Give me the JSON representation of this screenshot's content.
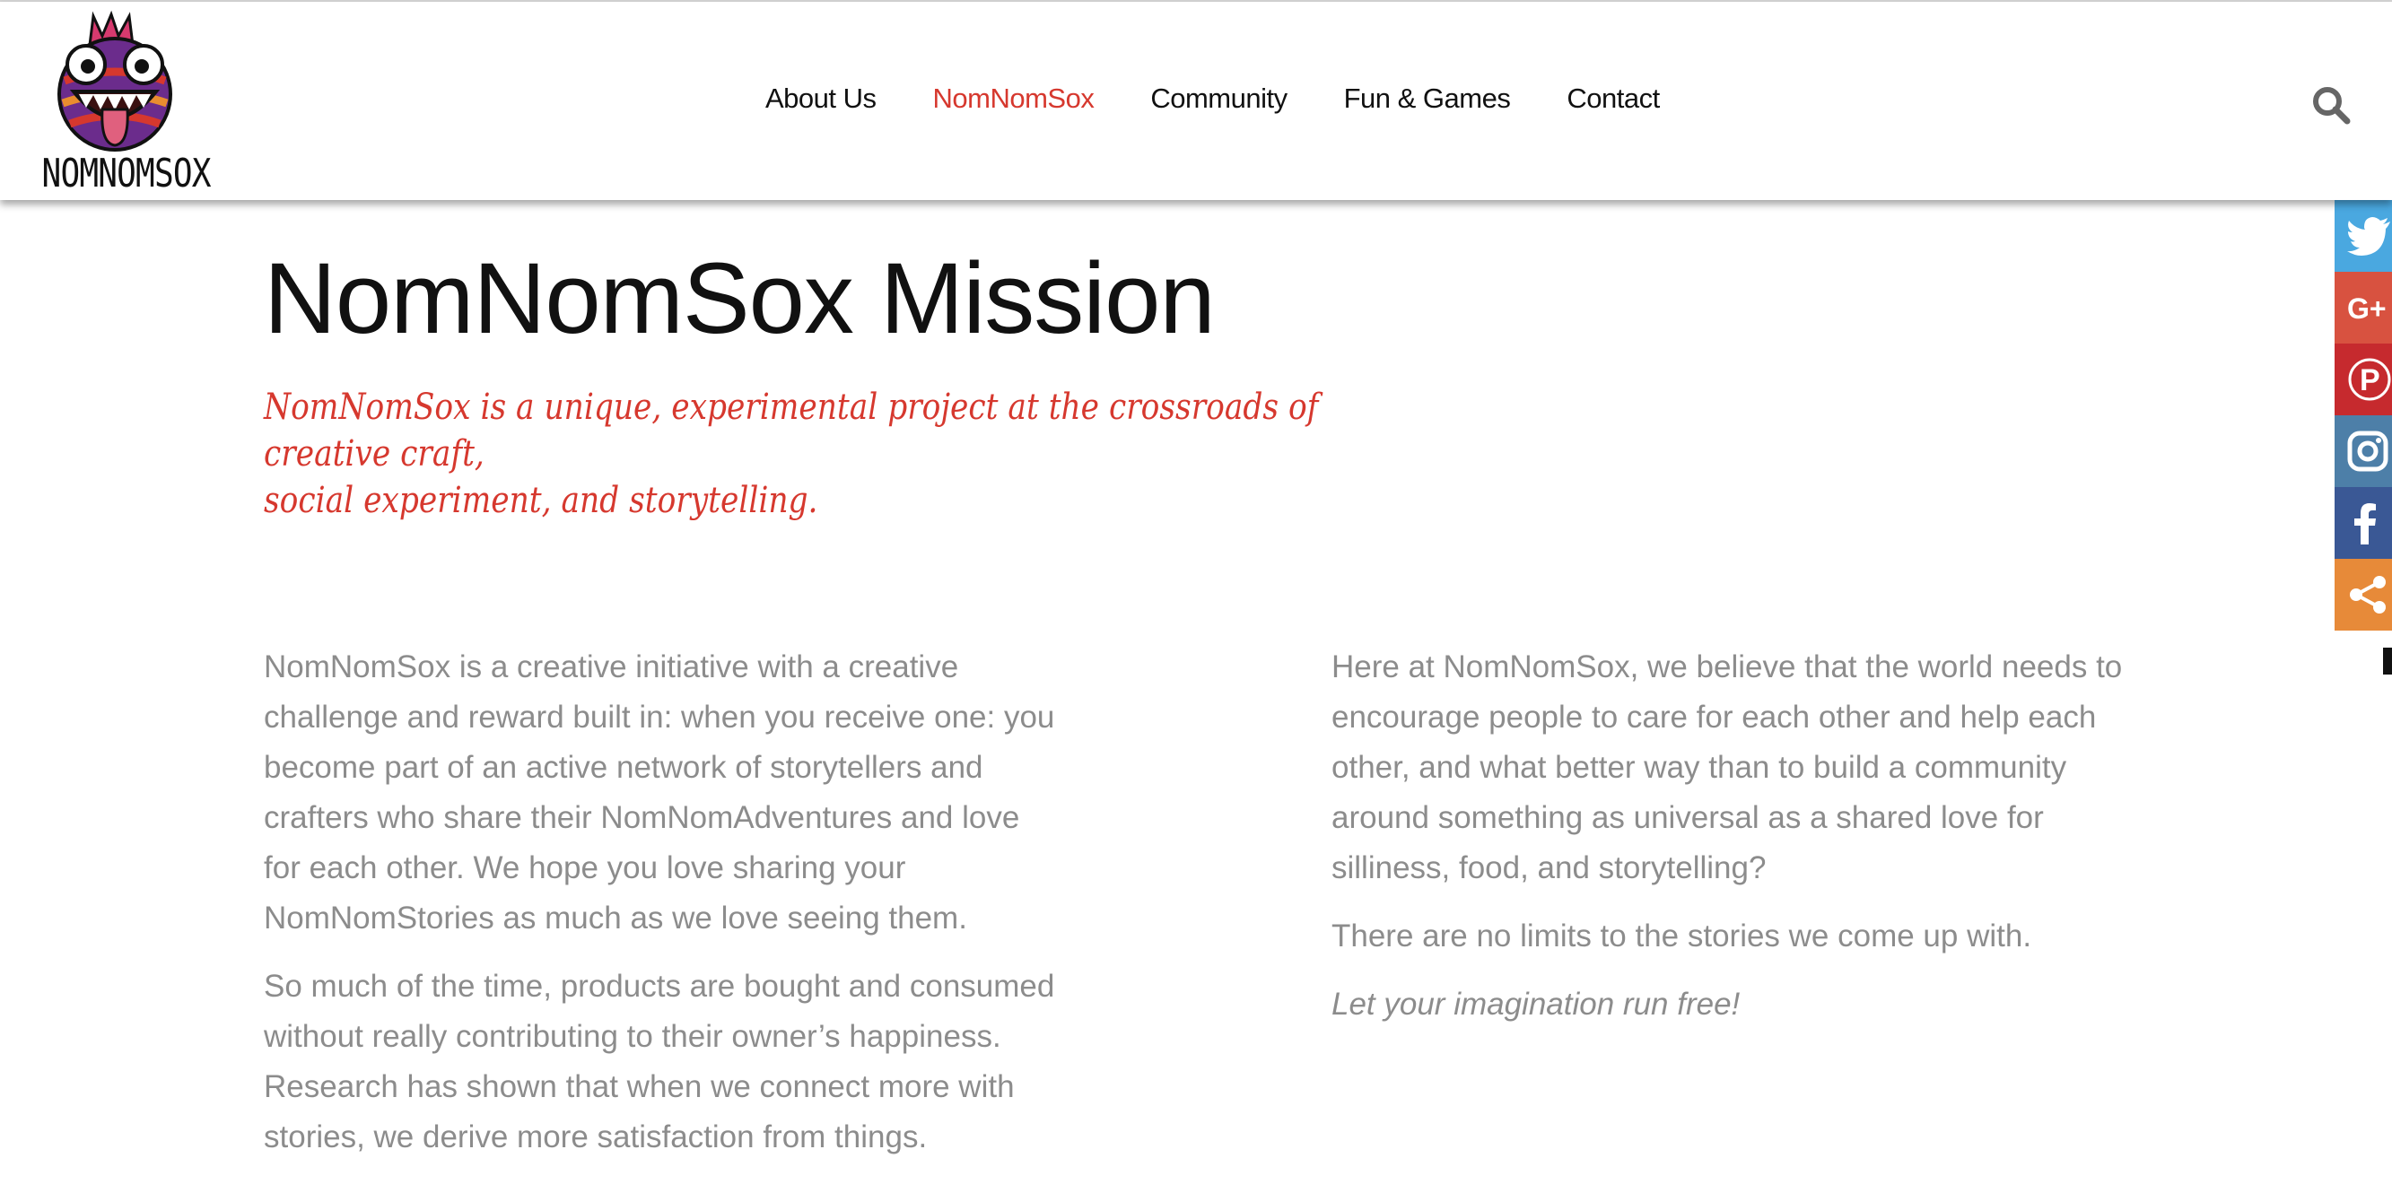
{
  "logo": {
    "text": "NOMNOMSOX"
  },
  "nav": {
    "items": [
      {
        "label": "About Us",
        "active": false
      },
      {
        "label": "NomNomSox",
        "active": true
      },
      {
        "label": "Community",
        "active": false
      },
      {
        "label": "Fun & Games",
        "active": false
      },
      {
        "label": "Contact",
        "active": false
      }
    ]
  },
  "search": {
    "icon": "search-icon"
  },
  "page": {
    "title": "NomNomSox Mission",
    "tagline_line1": "NomNomSox is a unique, experimental project at the crossroads of creative craft,",
    "tagline_line2": "social experiment, and storytelling.",
    "left_col": [
      "NomNomSox is a creative initiative with a creative challenge and reward built in: when you receive one: you become part of an active network of storytellers and crafters who share their NomNomAdventures and love for each other. We hope you love sharing your NomNomStories as much as we love seeing them.",
      "So much of the time, products are bought and consumed without really contributing to their owner’s happiness. Research has shown that when we connect more with stories, we derive more satisfaction from things."
    ],
    "right_col": [
      "Here at NomNomSox, we believe that the world needs to encourage people to care for each other and help each other, and what better way than to build a community around something as universal as a shared love for silliness, food, and storytelling?",
      "There are no limits to the stories we come up with."
    ],
    "right_col_emphasis": "Let your imagination run free!"
  },
  "share_bar": {
    "buttons": [
      "twitter-icon",
      "google-plus-icon",
      "pinterest-icon",
      "instagram-icon",
      "facebook-icon",
      "share-icon"
    ],
    "colors": [
      "#4aa8e0",
      "#d85240",
      "#c62a2e",
      "#4d7fa8",
      "#3a5895",
      "#e78a39"
    ]
  },
  "colors": {
    "accent": "#d6382e",
    "body_text": "#8c8c8c",
    "heading": "#111111"
  }
}
